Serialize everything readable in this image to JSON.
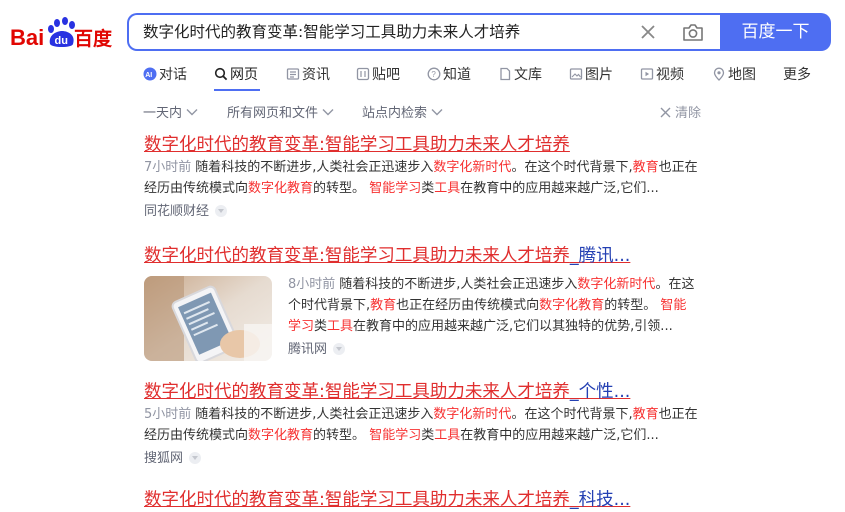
{
  "logo": {
    "text_left": "Bai",
    "text_paw": "du",
    "text_right": "百度"
  },
  "search": {
    "query": "数字化时代的教育变革:智能学习工具助力未来人才培养",
    "button": "百度一下"
  },
  "tabs": [
    {
      "label": "对话",
      "icon": "ai-icon"
    },
    {
      "label": "网页",
      "icon": "search-icon"
    },
    {
      "label": "资讯",
      "icon": "news-icon"
    },
    {
      "label": "贴吧",
      "icon": "tieba-icon"
    },
    {
      "label": "知道",
      "icon": "question-icon"
    },
    {
      "label": "文库",
      "icon": "doc-icon"
    },
    {
      "label": "图片",
      "icon": "image-icon"
    },
    {
      "label": "视频",
      "icon": "video-icon"
    },
    {
      "label": "地图",
      "icon": "map-icon"
    },
    {
      "label": "更多",
      "icon": ""
    }
  ],
  "filters": {
    "time": "一天内",
    "type": "所有网页和文件",
    "site": "站点内检索",
    "clear": "清除"
  },
  "results": [
    {
      "title_red": "数字化时代的教育变革:智能学习工具助力未来人才培养",
      "title_rest": "",
      "time": "7小时前",
      "a1": "随着科技的不断进步,人类社会正迅速步入",
      "e1": "数字化新时代",
      "a2": "。在这个时代背景下,",
      "e2": "教育",
      "a3": "也正在经历由传统模式向",
      "e3": "数字化教育",
      "a4": "的转型。",
      "e4": "智能学习",
      "a5": "类",
      "e5": "工具",
      "a6": "在教育中的应用越来越广泛,它们...",
      "source": "同花顺财经"
    },
    {
      "title_red": "数字化时代的教育变革:智能学习工具助力未来人才培养",
      "title_rest": "_腾讯...",
      "time": "8小时前",
      "a1": "随着科技的不断进步,人类社会正迅速步入",
      "e1": "数字化新时代",
      "a2": "。在这个时代背景下,",
      "e2": "教育",
      "a3": "也正在经历由传统模式向",
      "e3": "数字化教育",
      "a4": "的转型。",
      "e4": "智能学习",
      "a5": "类",
      "e5": "工具",
      "a6": "在教育中的应用越来越广泛,它们以其独特的优势,引领...",
      "source": "腾讯网"
    },
    {
      "title_red": "数字化时代的教育变革:智能学习工具助力未来人才培养",
      "title_rest": "_个性...",
      "time": "5小时前",
      "a1": "随着科技的不断进步,人类社会正迅速步入",
      "e1": "数字化新时代",
      "a2": "。在这个时代背景下,",
      "e2": "教育",
      "a3": "也正在经历由传统模式向",
      "e3": "数字化教育",
      "a4": "的转型。",
      "e4": "智能学习",
      "a5": "类",
      "e5": "工具",
      "a6": "在教育中的应用越来越广泛,它们...",
      "source": "搜狐网"
    },
    {
      "title_red": "数字化时代的教育变革:智能学习工具助力未来人才培养",
      "title_rest": "_科技..."
    }
  ],
  "colors": {
    "accent": "#4e6ef2",
    "title_red": "#e02e2e",
    "logo_red": "#e10602",
    "logo_blue": "#2932e1"
  }
}
